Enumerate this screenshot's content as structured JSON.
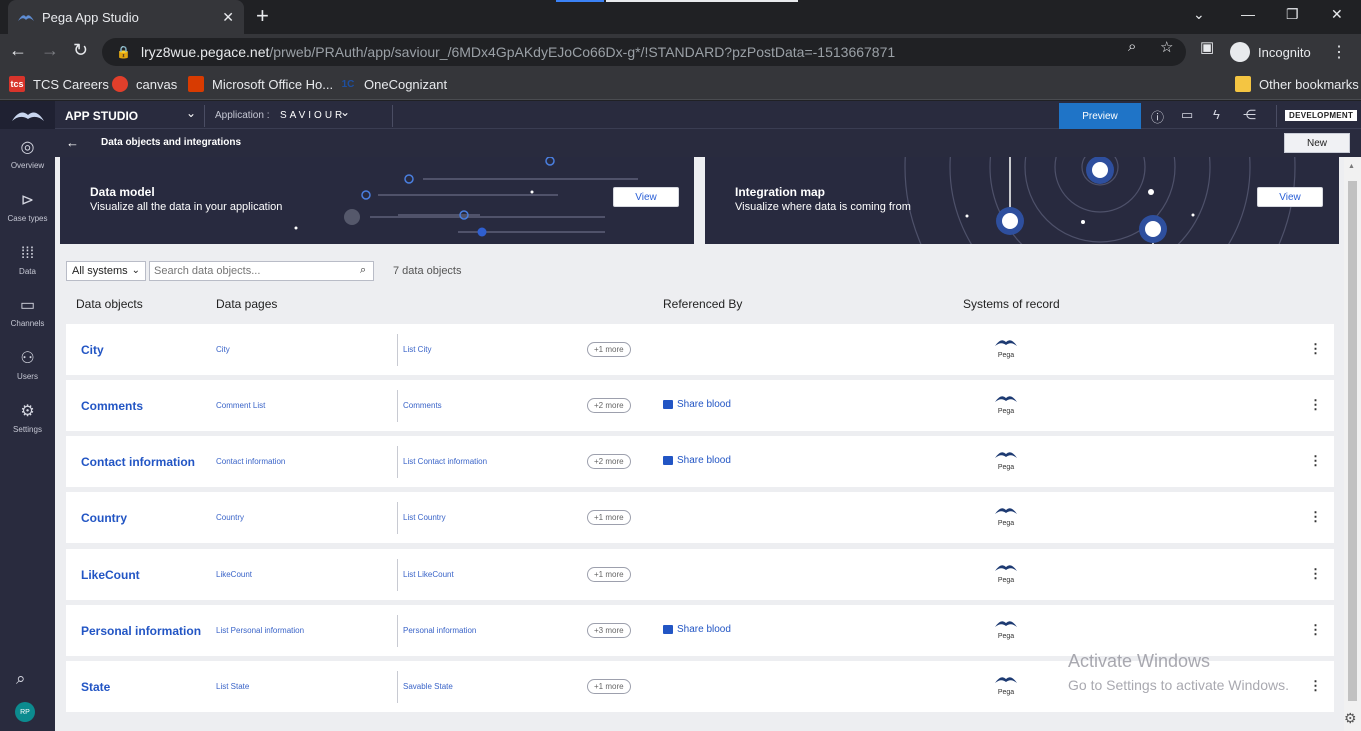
{
  "browser": {
    "tab_title": "Pega App Studio",
    "tab_close": "✕",
    "new_tab": "+",
    "url_host": "lryz8wue.pegace.net",
    "url_path": "/prweb/PRAuth/app/saviour_/6MDx4GpAKdyEJoCo66Dx-g*/!STANDARD?pzPostData=-1513667871",
    "profile_label": "Incognito",
    "bookmarks": [
      {
        "label": "TCS Careers",
        "icon": "tcs-logo"
      },
      {
        "label": "canvas",
        "icon": "canvas-logo"
      },
      {
        "label": "Microsoft Office Ho...",
        "icon": "office-logo"
      },
      {
        "label": "OneCognizant",
        "icon": "onecognizant-logo"
      }
    ],
    "other_bookmarks": "Other bookmarks"
  },
  "header": {
    "studio_title": "APP STUDIO",
    "application_label": "Application :",
    "application_name": "SAVIOUR",
    "preview_label": "Preview",
    "environment_badge": "DEVELOPMENT"
  },
  "subheader": {
    "title": "Data objects and integrations",
    "new_label": "New"
  },
  "rail": {
    "items": [
      {
        "label": "Overview",
        "icon": "overview-icon"
      },
      {
        "label": "Case types",
        "icon": "case-types-icon"
      },
      {
        "label": "Data",
        "icon": "data-grid-icon"
      },
      {
        "label": "Channels",
        "icon": "channels-icon"
      },
      {
        "label": "Users",
        "icon": "users-icon"
      },
      {
        "label": "Settings",
        "icon": "gear-icon"
      }
    ],
    "avatar_initials": "RP"
  },
  "banners": [
    {
      "title": "Data model",
      "subtitle": "Visualize all the data in your application",
      "view_label": "View"
    },
    {
      "title": "Integration map",
      "subtitle": "Visualize where data is coming from",
      "view_label": "View"
    }
  ],
  "filter": {
    "system_selected": "All systems",
    "search_placeholder": "Search data objects...",
    "count_text": "7 data objects"
  },
  "table": {
    "columns": [
      "Data objects",
      "Data pages",
      "Referenced By",
      "Systems of record"
    ],
    "rows": [
      {
        "name": "City",
        "page1": "City",
        "page2": "List City",
        "more": "+1 more",
        "ref": "",
        "system": "Pega"
      },
      {
        "name": "Comments",
        "page1": "Comment List",
        "page2": "Comments",
        "more": "+2 more",
        "ref": "Share blood",
        "system": "Pega"
      },
      {
        "name": "Contact information",
        "page1": "Contact information",
        "page2": "List Contact information",
        "more": "+2 more",
        "ref": "Share blood",
        "system": "Pega"
      },
      {
        "name": "Country",
        "page1": "Country",
        "page2": "List Country",
        "more": "+1 more",
        "ref": "",
        "system": "Pega"
      },
      {
        "name": "LikeCount",
        "page1": "LikeCount",
        "page2": "List LikeCount",
        "more": "+1 more",
        "ref": "",
        "system": "Pega"
      },
      {
        "name": "Personal information",
        "page1": "List Personal information",
        "page2": "Personal information",
        "more": "+3 more",
        "ref": "Share blood",
        "system": "Pega"
      },
      {
        "name": "State",
        "page1": "List State",
        "page2": "Savable State",
        "more": "+1 more",
        "ref": "",
        "system": "Pega"
      }
    ]
  },
  "watermark": {
    "line1": "Activate Windows",
    "line2": "Go to Settings to activate Windows."
  },
  "colors": {
    "accent": "#1f74c7",
    "link": "#2255c4",
    "header_bg": "#292b3e"
  }
}
